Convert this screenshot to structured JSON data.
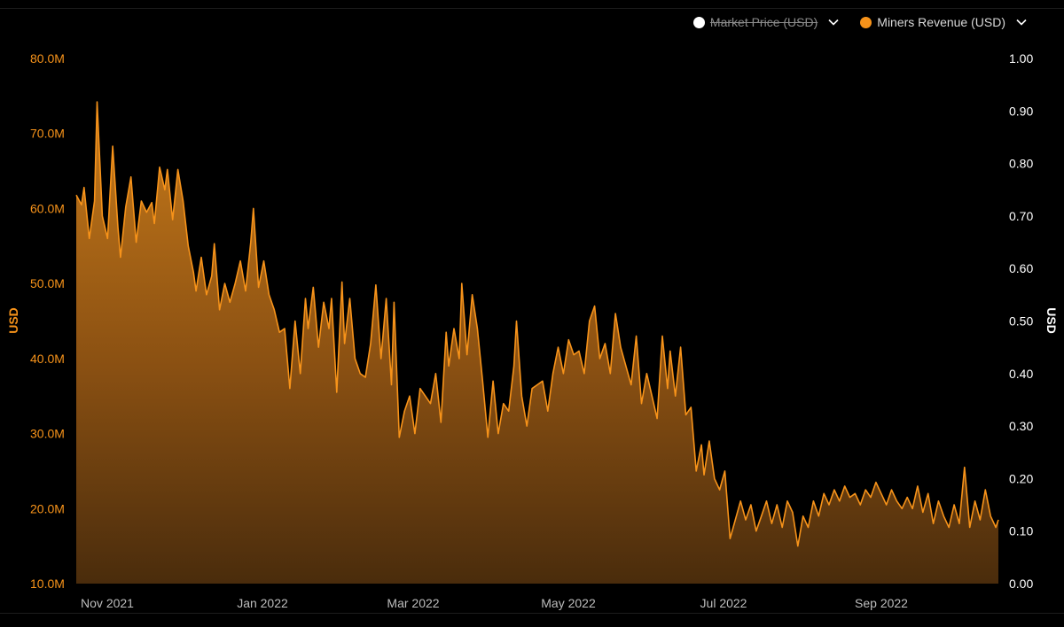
{
  "legend": {
    "items": [
      {
        "label": "Market Price (USD)",
        "color": "#ffffff",
        "hidden": true,
        "icon": "chevron-down-icon"
      },
      {
        "label": "Miners Revenue (USD)",
        "color": "#f7931a",
        "hidden": false,
        "icon": "chevron-down-icon"
      }
    ]
  },
  "colors": {
    "accent": "#f7931a",
    "left_axis_text": "#f7931a",
    "right_axis_text": "#ffffff",
    "x_axis_text": "#bdbdbd"
  },
  "chart_data": {
    "type": "area",
    "title": "",
    "grid": false,
    "legend_position": "top-right",
    "x_ticks": [
      "Nov 2021",
      "Jan 2022",
      "Mar 2022",
      "May 2022",
      "Jul 2022",
      "Sep 2022"
    ],
    "x_range": [
      "2021-10-24",
      "2022-10-13"
    ],
    "left_axis": {
      "label": "USD",
      "range": [
        10000000,
        80000000
      ],
      "tick_labels": [
        "10.0M",
        "20.0M",
        "30.0M",
        "40.0M",
        "50.0M",
        "60.0M",
        "70.0M",
        "80.0M"
      ]
    },
    "right_axis": {
      "label": "USD",
      "range": [
        0,
        1
      ],
      "tick_labels": [
        "0.00",
        "0.10",
        "0.20",
        "0.30",
        "0.40",
        "0.50",
        "0.60",
        "0.70",
        "0.80",
        "0.90",
        "1.00"
      ]
    },
    "series": [
      {
        "name": "Miners Revenue (USD)",
        "axis": "left",
        "color": "#f7931a",
        "points": [
          [
            "2021-10-24",
            61.8
          ],
          [
            "2021-10-26",
            60.5
          ],
          [
            "2021-10-27",
            62.8
          ],
          [
            "2021-10-29",
            56.0
          ],
          [
            "2021-10-31",
            61.0
          ],
          [
            "2021-11-01",
            74.2
          ],
          [
            "2021-11-03",
            59.0
          ],
          [
            "2021-11-05",
            56.0
          ],
          [
            "2021-11-07",
            68.3
          ],
          [
            "2021-11-09",
            57.5
          ],
          [
            "2021-11-10",
            53.5
          ],
          [
            "2021-11-12",
            60.2
          ],
          [
            "2021-11-14",
            64.2
          ],
          [
            "2021-11-16",
            55.5
          ],
          [
            "2021-11-18",
            61.0
          ],
          [
            "2021-11-20",
            59.5
          ],
          [
            "2021-11-22",
            60.8
          ],
          [
            "2021-11-23",
            58.0
          ],
          [
            "2021-11-25",
            65.5
          ],
          [
            "2021-11-27",
            62.5
          ],
          [
            "2021-11-28",
            65.2
          ],
          [
            "2021-11-30",
            58.5
          ],
          [
            "2021-12-02",
            65.2
          ],
          [
            "2021-12-04",
            61.0
          ],
          [
            "2021-12-06",
            55.0
          ],
          [
            "2021-12-08",
            51.5
          ],
          [
            "2021-12-09",
            49.0
          ],
          [
            "2021-12-11",
            53.5
          ],
          [
            "2021-12-13",
            48.5
          ],
          [
            "2021-12-15",
            51.0
          ],
          [
            "2021-12-16",
            55.3
          ],
          [
            "2021-12-18",
            46.5
          ],
          [
            "2021-12-20",
            50.0
          ],
          [
            "2021-12-22",
            47.5
          ],
          [
            "2021-12-24",
            50.0
          ],
          [
            "2021-12-26",
            53.0
          ],
          [
            "2021-12-28",
            49.0
          ],
          [
            "2021-12-30",
            55.5
          ],
          [
            "2021-12-31",
            60.0
          ],
          [
            "2022-01-02",
            49.5
          ],
          [
            "2022-01-04",
            53.0
          ],
          [
            "2022-01-06",
            48.5
          ],
          [
            "2022-01-08",
            46.5
          ],
          [
            "2022-01-10",
            43.5
          ],
          [
            "2022-01-12",
            44.0
          ],
          [
            "2022-01-14",
            36.0
          ],
          [
            "2022-01-16",
            45.0
          ],
          [
            "2022-01-18",
            38.0
          ],
          [
            "2022-01-20",
            48.0
          ],
          [
            "2022-01-21",
            44.0
          ],
          [
            "2022-01-23",
            49.5
          ],
          [
            "2022-01-25",
            41.5
          ],
          [
            "2022-01-27",
            47.5
          ],
          [
            "2022-01-29",
            44.0
          ],
          [
            "2022-01-30",
            48.0
          ],
          [
            "2022-02-01",
            35.5
          ],
          [
            "2022-02-03",
            50.2
          ],
          [
            "2022-02-04",
            42.0
          ],
          [
            "2022-02-06",
            48.0
          ],
          [
            "2022-02-08",
            40.0
          ],
          [
            "2022-02-10",
            38.0
          ],
          [
            "2022-02-12",
            37.5
          ],
          [
            "2022-02-14",
            42.0
          ],
          [
            "2022-02-16",
            49.8
          ],
          [
            "2022-02-18",
            40.0
          ],
          [
            "2022-02-20",
            48.0
          ],
          [
            "2022-02-22",
            36.5
          ],
          [
            "2022-02-23",
            47.5
          ],
          [
            "2022-02-25",
            29.5
          ],
          [
            "2022-02-27",
            33.0
          ],
          [
            "2022-03-01",
            35.0
          ],
          [
            "2022-03-03",
            30.0
          ],
          [
            "2022-03-05",
            36.0
          ],
          [
            "2022-03-07",
            35.0
          ],
          [
            "2022-03-09",
            34.0
          ],
          [
            "2022-03-11",
            38.0
          ],
          [
            "2022-03-13",
            31.5
          ],
          [
            "2022-03-15",
            43.5
          ],
          [
            "2022-03-16",
            39.0
          ],
          [
            "2022-03-18",
            44.0
          ],
          [
            "2022-03-20",
            40.0
          ],
          [
            "2022-03-21",
            50.0
          ],
          [
            "2022-03-23",
            40.5
          ],
          [
            "2022-03-25",
            48.5
          ],
          [
            "2022-03-27",
            44.0
          ],
          [
            "2022-03-29",
            37.0
          ],
          [
            "2022-03-31",
            29.5
          ],
          [
            "2022-04-02",
            37.0
          ],
          [
            "2022-04-04",
            30.0
          ],
          [
            "2022-04-06",
            34.0
          ],
          [
            "2022-04-08",
            33.0
          ],
          [
            "2022-04-10",
            39.0
          ],
          [
            "2022-04-11",
            45.0
          ],
          [
            "2022-04-13",
            35.0
          ],
          [
            "2022-04-15",
            31.0
          ],
          [
            "2022-04-17",
            36.0
          ],
          [
            "2022-04-19",
            36.5
          ],
          [
            "2022-04-21",
            37.0
          ],
          [
            "2022-04-23",
            33.0
          ],
          [
            "2022-04-25",
            38.0
          ],
          [
            "2022-04-27",
            41.5
          ],
          [
            "2022-04-29",
            38.0
          ],
          [
            "2022-05-01",
            42.5
          ],
          [
            "2022-05-03",
            40.5
          ],
          [
            "2022-05-05",
            41.0
          ],
          [
            "2022-05-07",
            38.0
          ],
          [
            "2022-05-09",
            45.0
          ],
          [
            "2022-05-11",
            47.0
          ],
          [
            "2022-05-13",
            40.0
          ],
          [
            "2022-05-15",
            42.0
          ],
          [
            "2022-05-17",
            38.0
          ],
          [
            "2022-05-19",
            46.0
          ],
          [
            "2022-05-21",
            41.5
          ],
          [
            "2022-05-23",
            39.0
          ],
          [
            "2022-05-25",
            36.5
          ],
          [
            "2022-05-27",
            43.0
          ],
          [
            "2022-05-29",
            34.0
          ],
          [
            "2022-05-31",
            38.0
          ],
          [
            "2022-06-02",
            35.0
          ],
          [
            "2022-06-04",
            32.0
          ],
          [
            "2022-06-06",
            43.0
          ],
          [
            "2022-06-08",
            36.0
          ],
          [
            "2022-06-09",
            41.0
          ],
          [
            "2022-06-11",
            35.0
          ],
          [
            "2022-06-13",
            41.5
          ],
          [
            "2022-06-15",
            32.5
          ],
          [
            "2022-06-17",
            33.5
          ],
          [
            "2022-06-19",
            25.0
          ],
          [
            "2022-06-21",
            28.5
          ],
          [
            "2022-06-22",
            24.5
          ],
          [
            "2022-06-24",
            29.0
          ],
          [
            "2022-06-26",
            24.0
          ],
          [
            "2022-06-28",
            22.5
          ],
          [
            "2022-06-30",
            25.0
          ],
          [
            "2022-07-02",
            16.0
          ],
          [
            "2022-07-04",
            18.5
          ],
          [
            "2022-07-06",
            21.0
          ],
          [
            "2022-07-08",
            18.5
          ],
          [
            "2022-07-10",
            20.5
          ],
          [
            "2022-07-12",
            17.0
          ],
          [
            "2022-07-14",
            19.0
          ],
          [
            "2022-07-16",
            21.0
          ],
          [
            "2022-07-18",
            18.0
          ],
          [
            "2022-07-20",
            20.5
          ],
          [
            "2022-07-22",
            17.5
          ],
          [
            "2022-07-24",
            21.0
          ],
          [
            "2022-07-26",
            19.5
          ],
          [
            "2022-07-28",
            15.0
          ],
          [
            "2022-07-30",
            19.0
          ],
          [
            "2022-08-01",
            17.5
          ],
          [
            "2022-08-03",
            21.0
          ],
          [
            "2022-08-05",
            19.0
          ],
          [
            "2022-08-07",
            22.0
          ],
          [
            "2022-08-09",
            20.5
          ],
          [
            "2022-08-11",
            22.5
          ],
          [
            "2022-08-13",
            21.0
          ],
          [
            "2022-08-15",
            23.0
          ],
          [
            "2022-08-17",
            21.5
          ],
          [
            "2022-08-19",
            22.0
          ],
          [
            "2022-08-21",
            20.5
          ],
          [
            "2022-08-23",
            22.5
          ],
          [
            "2022-08-25",
            21.5
          ],
          [
            "2022-08-27",
            23.5
          ],
          [
            "2022-08-29",
            22.0
          ],
          [
            "2022-08-31",
            20.5
          ],
          [
            "2022-09-02",
            22.5
          ],
          [
            "2022-09-04",
            21.0
          ],
          [
            "2022-09-06",
            20.0
          ],
          [
            "2022-09-08",
            21.5
          ],
          [
            "2022-09-10",
            20.0
          ],
          [
            "2022-09-12",
            23.0
          ],
          [
            "2022-09-14",
            19.5
          ],
          [
            "2022-09-16",
            22.0
          ],
          [
            "2022-09-18",
            18.0
          ],
          [
            "2022-09-20",
            21.0
          ],
          [
            "2022-09-22",
            19.0
          ],
          [
            "2022-09-24",
            17.5
          ],
          [
            "2022-09-26",
            20.5
          ],
          [
            "2022-09-28",
            18.0
          ],
          [
            "2022-09-30",
            25.5
          ],
          [
            "2022-10-02",
            17.5
          ],
          [
            "2022-10-04",
            21.0
          ],
          [
            "2022-10-06",
            18.5
          ],
          [
            "2022-10-08",
            22.5
          ],
          [
            "2022-10-10",
            19.0
          ],
          [
            "2022-10-12",
            17.5
          ],
          [
            "2022-10-13",
            18.5
          ]
        ]
      }
    ]
  }
}
